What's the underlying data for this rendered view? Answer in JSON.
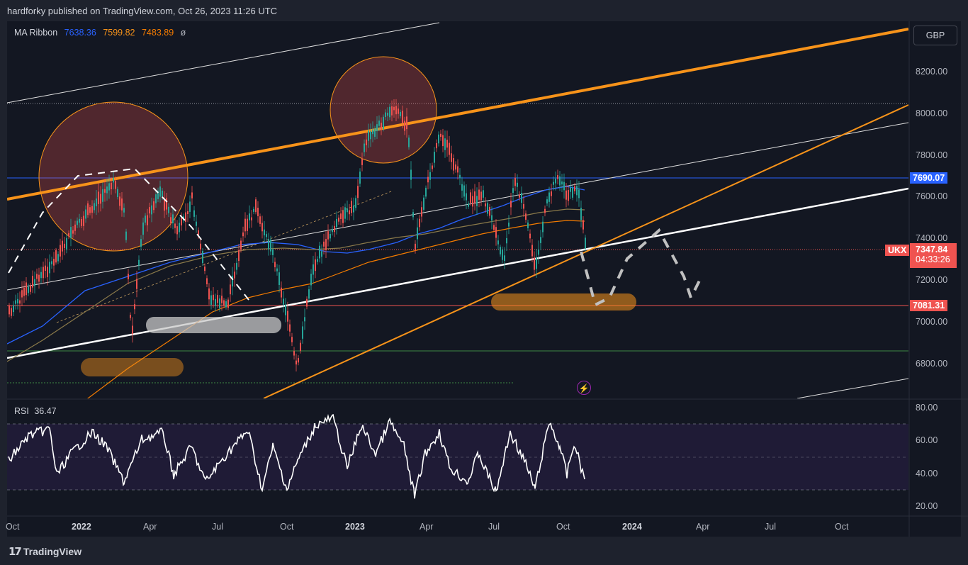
{
  "header": {
    "publisher_text": "hardforky published on TradingView.com, Oct 26, 2023 11:26 UTC"
  },
  "legend": {
    "name": "MA Ribbon",
    "v1": "7638.36",
    "v2": "7599.82",
    "v3": "7483.89",
    "symbol": "ø"
  },
  "currency": "GBP",
  "price_axis": [
    "8200.00",
    "8000.00",
    "7800.00",
    "7600.00",
    "7400.00",
    "7200.00",
    "7000.00",
    "6800.00"
  ],
  "price_tags": {
    "blue": "7690.07",
    "symbol": "UKX",
    "last": "7347.84",
    "countdown": "04:33:26",
    "red": "7081.31"
  },
  "rsi": {
    "label": "RSI",
    "value": "36.47",
    "axis": [
      "80.00",
      "60.00",
      "40.00",
      "20.00"
    ]
  },
  "time_axis": [
    "Oct",
    "2022",
    "Apr",
    "Jul",
    "Oct",
    "2023",
    "Apr",
    "Jul",
    "Oct",
    "2024",
    "Apr",
    "Jul",
    "Oct"
  ],
  "footer": {
    "brand": "TradingView",
    "logo": "tradingview-logo-icon"
  },
  "colors": {
    "up": "#26a69a",
    "down": "#ef5350",
    "orange": "#f7931a",
    "blue": "#2962ff",
    "rsi_bg": "#1f1b36"
  }
}
